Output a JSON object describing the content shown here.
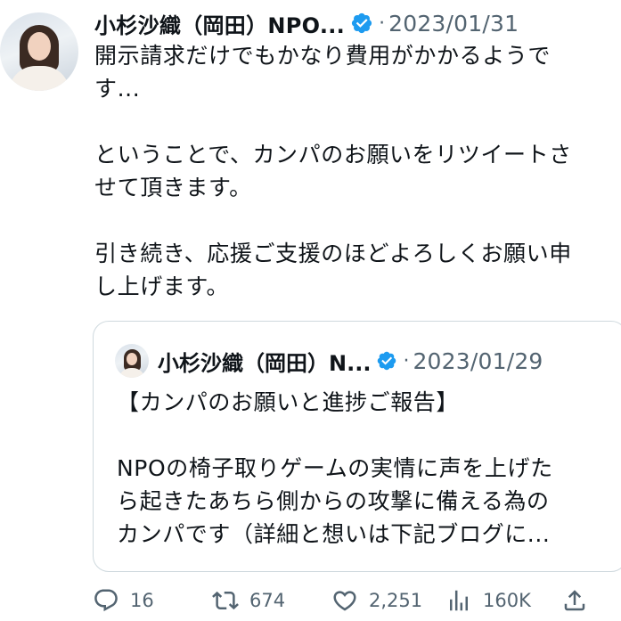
{
  "tweet": {
    "author_name": "小杉沙織（岡田）NPO...",
    "separator": "·",
    "date": "2023/01/31",
    "text": "開示請求だけでもかなり費用がかかるようで\nす...\n\nということで、カンパのお願いをリツイートさ\nせて頂きます。\n\n引き続き、応援ご支援のほどよろしくお願い申\nし上げます。"
  },
  "quote": {
    "author_name": "小杉沙織（岡田）N...",
    "separator": "·",
    "date": "2023/01/29",
    "text": "【カンパのお願いと進捗ご報告】\n\nNPOの椅子取りゲームの実情に声を上げた\nら起きたあちら側からの攻撃に備える為の\nカンパです（詳細と想いは下記ブログに..."
  },
  "actions": {
    "replies": "16",
    "retweets": "674",
    "likes": "2,251",
    "views": "160K"
  },
  "colors": {
    "text": "#0f1419",
    "muted": "#536471",
    "verified": "#1d9bf0",
    "border": "#cfd9de"
  },
  "icons": [
    "avatar",
    "verified-badge-icon",
    "reply-icon",
    "retweet-icon",
    "like-icon",
    "views-icon",
    "share-icon"
  ]
}
